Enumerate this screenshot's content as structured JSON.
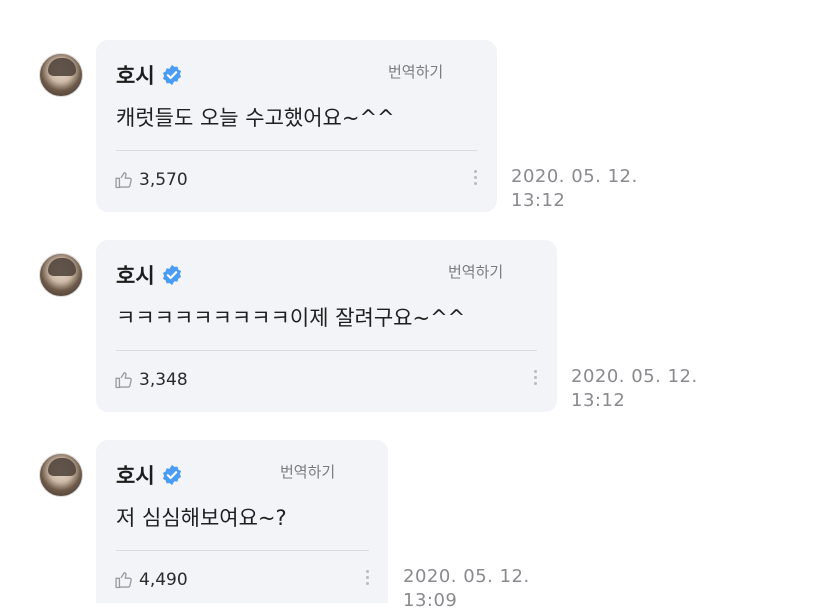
{
  "comments": [
    {
      "author": "호시",
      "translate_label": "번역하기",
      "text": "캐럿들도 오늘 수고했어요~^^",
      "likes": "3,570",
      "date": "2020. 05. 12.",
      "time": "13:12"
    },
    {
      "author": "호시",
      "translate_label": "번역하기",
      "text": "ㅋㅋㅋㅋㅋㅋㅋㅋㅋ이제 잘려구요~^^",
      "likes": "3,348",
      "date": "2020. 05. 12.",
      "time": "13:12"
    },
    {
      "author": "호시",
      "translate_label": "번역하기",
      "text": "저 심심해보여요~?",
      "likes": "4,490",
      "date": "2020. 05. 12.",
      "time": "13:09"
    }
  ],
  "icons": {
    "verified": "verified-badge-icon",
    "like": "thumbs-up-icon",
    "more": "more-vertical-icon"
  },
  "colors": {
    "bubble_bg": "#f3f4f8",
    "verified_blue": "#4a9cf5",
    "muted_text": "#8a8a8f"
  }
}
